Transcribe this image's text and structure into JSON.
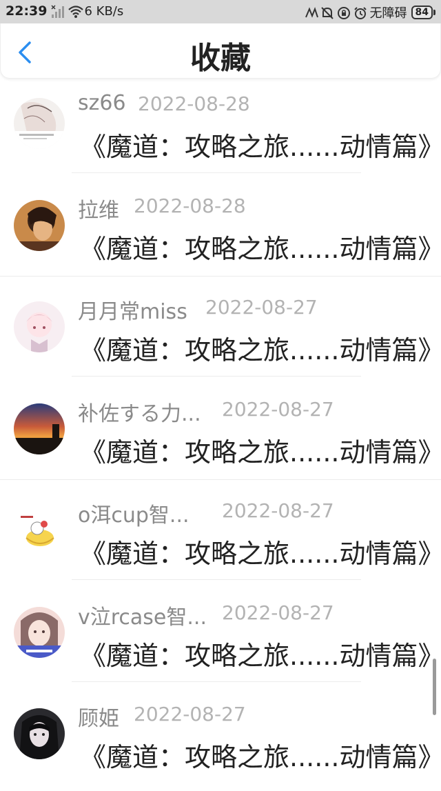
{
  "status_bar": {
    "time": "22:39",
    "net_speed": "6 KB/s",
    "no_barrier": "无障碍",
    "battery": "84"
  },
  "header": {
    "title": "收藏"
  },
  "items": [
    {
      "user": "sz66",
      "date": "2022-08-28",
      "title": "《魔道：攻略之旅......动情篇》"
    },
    {
      "user": "拉维",
      "date": "2022-08-28",
      "title": "《魔道：攻略之旅......动情篇》"
    },
    {
      "user": "月月常miss",
      "date": "2022-08-27",
      "title": "《魔道：攻略之旅......动情篇》"
    },
    {
      "user": "补佐する力...",
      "date": "2022-08-27",
      "title": "《魔道：攻略之旅......动情篇》"
    },
    {
      "user": "o洱cup智...",
      "date": "2022-08-27",
      "title": "《魔道：攻略之旅......动情篇》"
    },
    {
      "user": "v泣rcase智...",
      "date": "2022-08-27",
      "title": "《魔道：攻略之旅......动情篇》"
    },
    {
      "user": "顾姫",
      "date": "2022-08-27",
      "title": "《魔道：攻略之旅......动情篇》"
    }
  ],
  "colors": {
    "accent": "#2b8ef0",
    "name_gray": "#8a8a8a",
    "date_gray": "#b3b3b3"
  }
}
